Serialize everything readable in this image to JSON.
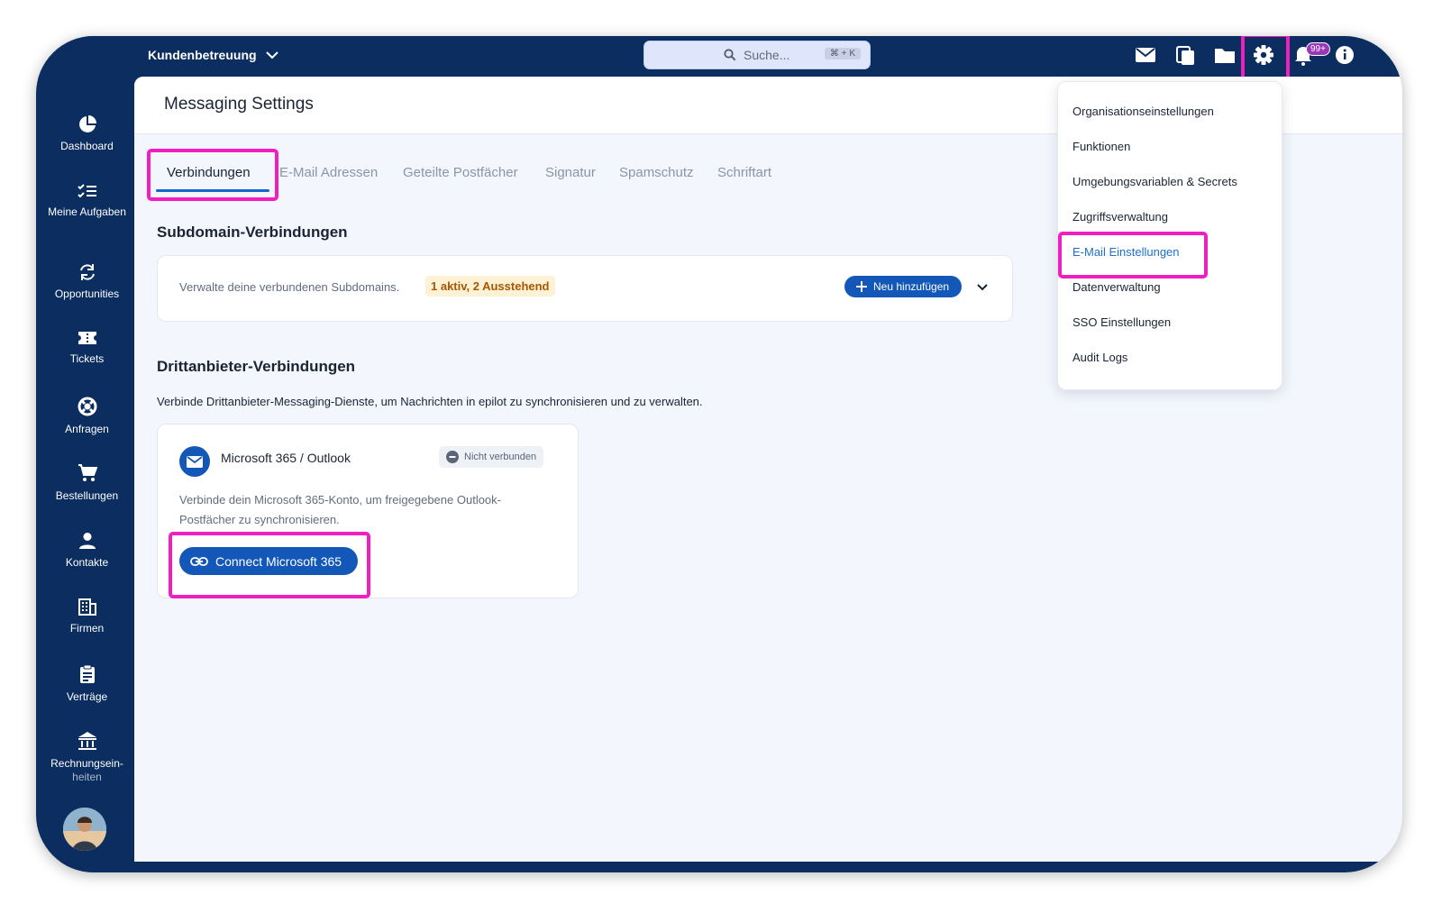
{
  "topbar": {
    "org_name": "Kundenbetreuung",
    "search_placeholder": "Suche...",
    "search_shortcut": "⌘ + K",
    "notification_count": "99+"
  },
  "sidebar": {
    "items": [
      {
        "label": "Dashboard",
        "icon": "dashboard-icon"
      },
      {
        "label": "Meine Aufgaben",
        "icon": "tasks-icon"
      },
      {
        "label": "Opportunities",
        "icon": "sync-icon"
      },
      {
        "label": "Tickets",
        "icon": "ticket-icon"
      },
      {
        "label": "Anfragen",
        "icon": "support-icon"
      },
      {
        "label": "Bestellungen",
        "icon": "cart-icon"
      },
      {
        "label": "Kontakte",
        "icon": "person-icon"
      },
      {
        "label": "Firmen",
        "icon": "building-icon"
      },
      {
        "label": "Verträge",
        "icon": "clipboard-icon"
      },
      {
        "label": "Rechnungsein-",
        "sub": "heiten",
        "icon": "bank-icon"
      }
    ]
  },
  "page": {
    "title": "Messaging Settings",
    "tabs": [
      "Verbindungen",
      "E-Mail Adressen",
      "Geteilte Postfächer",
      "Signatur",
      "Spamschutz",
      "Schriftart"
    ],
    "active_tab": "Verbindungen"
  },
  "subdomain": {
    "title": "Subdomain-Verbindungen",
    "description": "Verwalte deine verbundenen Subdomains.",
    "status": "1 aktiv, 2 Ausstehend",
    "add_label": "Neu hinzufügen"
  },
  "thirdparty": {
    "title": "Drittanbieter-Verbindungen",
    "description": "Verbinde Drittanbieter-Messaging-Dienste, um Nachrichten in epilot zu synchronisieren und zu verwalten.",
    "card": {
      "name": "Microsoft 365 / Outlook",
      "status": "Nicht verbunden",
      "desc_line1": "Verbinde dein Microsoft 365-Konto, um freigegebene Outlook-",
      "desc_line2": "Postfächer zu synchronisieren.",
      "button": "Connect Microsoft 365"
    }
  },
  "settings_menu": {
    "items": [
      "Organisationseinstellungen",
      "Funktionen",
      "Umgebungsvariablen & Secrets",
      "Zugriffsverwaltung",
      "E-Mail Einstellungen",
      "Datenverwaltung",
      "SSO Einstellungen",
      "Audit Logs"
    ],
    "active": "E-Mail Einstellungen"
  },
  "colors": {
    "navy": "#0b2d5f",
    "primary": "#1358b8",
    "highlight": "#f01fc0",
    "pending_bg": "#fdf1d6",
    "pending_text": "#a85600"
  }
}
